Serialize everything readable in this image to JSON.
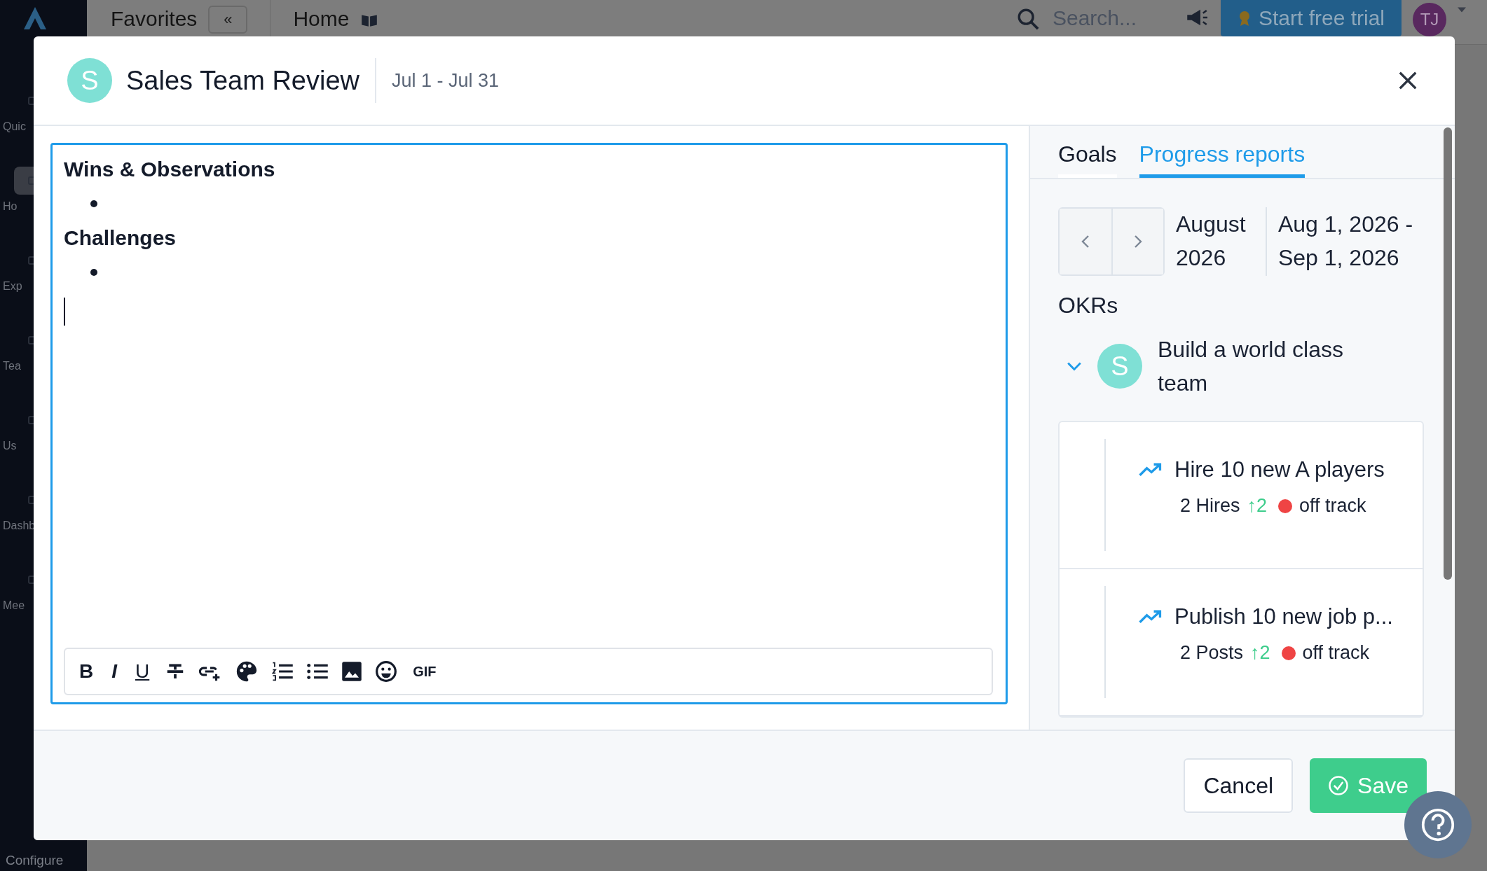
{
  "top_bar": {
    "favorites_label": "Favorites",
    "collapse_button": "«",
    "page_title": "Home",
    "search": {
      "placeholder": "Search..."
    },
    "trial_button": "Start free trial",
    "user_initials": "TJ"
  },
  "sidebar": {
    "items": [
      {
        "label": "Quic",
        "selected": false
      },
      {
        "label": "Ho",
        "selected": true
      },
      {
        "label": "Exp",
        "selected": false
      },
      {
        "label": "Tea",
        "selected": false
      },
      {
        "label": "Us",
        "selected": false
      },
      {
        "label": "Dashb",
        "selected": false
      },
      {
        "label": "Mee",
        "selected": false
      }
    ],
    "footer_item": "Configure"
  },
  "modal": {
    "avatar_letter": "S",
    "title": "Sales Team Review",
    "date_range": "Jul 1 - Jul 31",
    "editor": {
      "sections": [
        {
          "heading": "Wins & Observations",
          "empty_bullet": true
        },
        {
          "heading": "Challenges",
          "empty_bullet": true
        }
      ],
      "toolbar": [
        {
          "kind": "bold",
          "label": "B"
        },
        {
          "kind": "italic",
          "label": "I"
        },
        {
          "kind": "underline",
          "label": "U"
        },
        {
          "kind": "strike"
        },
        {
          "kind": "link"
        },
        {
          "kind": "palette"
        },
        {
          "kind": "ordered"
        },
        {
          "kind": "bullets"
        },
        {
          "kind": "image"
        },
        {
          "kind": "emoji"
        },
        {
          "kind": "gif",
          "label": "GIF"
        }
      ]
    },
    "panel": {
      "tabs": [
        {
          "label": "Goals",
          "selected": false
        },
        {
          "label": "Progress reports",
          "selected": true
        }
      ],
      "period": {
        "month": "August 2026",
        "range": "Aug 1, 2026 - Sep 1, 2026"
      },
      "section_title": "OKRs",
      "objective": {
        "avatar_letter": "S",
        "title": "Build a world class team",
        "expanded": true,
        "key_results": [
          {
            "title": "Hire 10 new A players",
            "metric": "2 Hires",
            "delta": "↑2",
            "status": "off track",
            "color": "#ef4444"
          },
          {
            "title": "Publish 10 new job p...",
            "metric": "2 Posts",
            "delta": "↑2",
            "status": "off track",
            "color": "#ef4444"
          }
        ]
      }
    },
    "buttons": [
      {
        "kind": "secondary",
        "label": "Cancel"
      },
      {
        "kind": "primary",
        "label": "Save"
      }
    ]
  }
}
